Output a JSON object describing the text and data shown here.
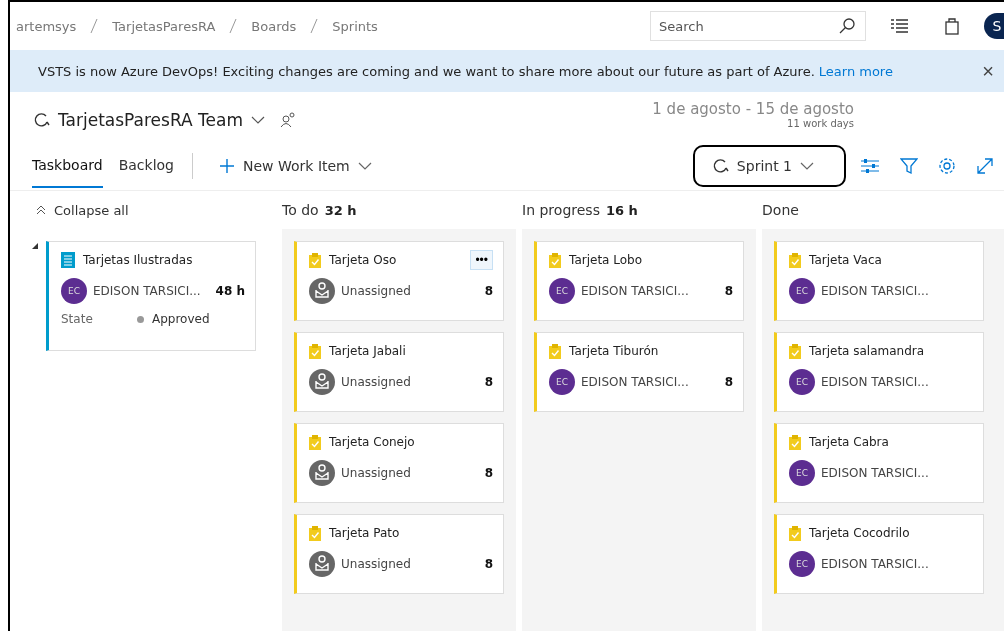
{
  "breadcrumb": [
    "artemsys",
    "TarjetasParesRA",
    "Boards",
    "Sprints"
  ],
  "search": {
    "placeholder": "Search"
  },
  "user_avatar": {
    "initial": "S"
  },
  "banner": {
    "text": "VSTS is now Azure DevOps! Exciting changes are coming and we want to share more about our future as part of Azure.",
    "link": "Learn more",
    "close": "×"
  },
  "team": {
    "name": "TarjetasParesRA Team"
  },
  "dates": {
    "range": "1 de agosto - 15 de agosto",
    "work_days": "11 work days"
  },
  "tabs": [
    {
      "label": "Taskboard",
      "selected": true
    },
    {
      "label": "Backlog",
      "selected": false
    }
  ],
  "new_item": {
    "label": "New Work Item"
  },
  "sprint": {
    "label": "Sprint 1"
  },
  "collapse_all": "Collapse all",
  "parent": {
    "title": "Tarjetas Ilustradas",
    "initials": "EC",
    "assignee": "EDISON TARSICI...",
    "hours": "48 h",
    "state_label": "State",
    "state": "Approved"
  },
  "columns": [
    {
      "name": "To do",
      "hours": "32 h",
      "cards": [
        {
          "title": "Tarjeta Oso",
          "kind": "unassigned",
          "assignee": "Unassigned",
          "hours": "8",
          "more": "•••"
        },
        {
          "title": "Tarjeta Jabali",
          "kind": "unassigned",
          "assignee": "Unassigned",
          "hours": "8"
        },
        {
          "title": "Tarjeta Conejo",
          "kind": "unassigned",
          "assignee": "Unassigned",
          "hours": "8"
        },
        {
          "title": "Tarjeta Pato",
          "kind": "unassigned",
          "assignee": "Unassigned",
          "hours": "8"
        }
      ]
    },
    {
      "name": "In progress",
      "hours": "16 h",
      "cards": [
        {
          "title": "Tarjeta Lobo",
          "kind": "person",
          "initials": "EC",
          "assignee": "EDISON TARSICI...",
          "hours": "8"
        },
        {
          "title": "Tarjeta Tiburón",
          "kind": "person",
          "initials": "EC",
          "assignee": "EDISON TARSICI...",
          "hours": "8"
        }
      ]
    },
    {
      "name": "Done",
      "cards": [
        {
          "title": "Tarjeta Vaca",
          "kind": "person",
          "initials": "EC",
          "assignee": "EDISON TARSICI..."
        },
        {
          "title": "Tarjeta salamandra",
          "kind": "person",
          "initials": "EC",
          "assignee": "EDISON TARSICI..."
        },
        {
          "title": "Tarjeta Cabra",
          "kind": "person",
          "initials": "EC",
          "assignee": "EDISON TARSICI..."
        },
        {
          "title": "Tarjeta Cocodrilo",
          "kind": "person",
          "initials": "EC",
          "assignee": "EDISON TARSICI..."
        }
      ]
    }
  ]
}
